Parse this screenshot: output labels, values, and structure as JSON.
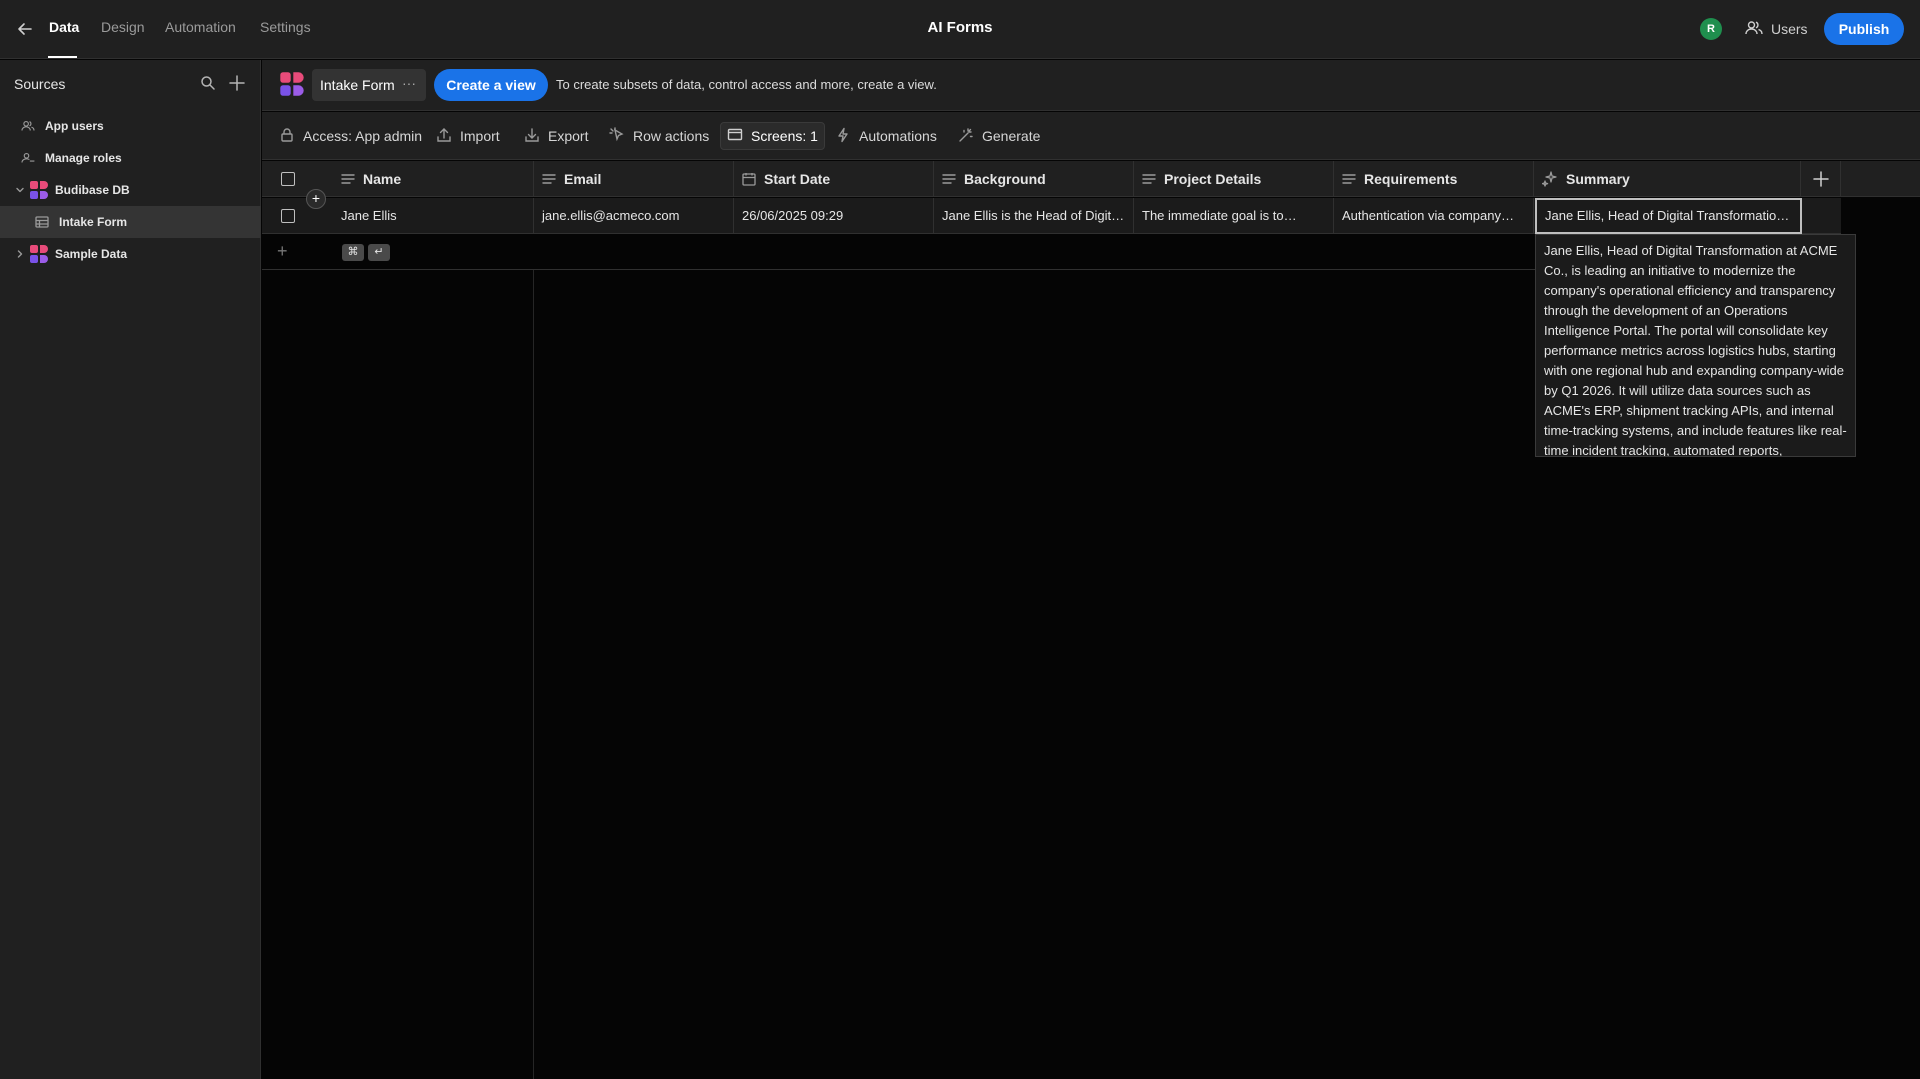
{
  "nav": {
    "tabs": [
      "Data",
      "Design",
      "Automation",
      "Settings"
    ],
    "active_tab": "Data"
  },
  "app": {
    "title": "AI Forms",
    "avatar_initial": "R",
    "users_label": "Users",
    "publish_label": "Publish"
  },
  "sidebar": {
    "title": "Sources",
    "items": [
      {
        "label": "App users",
        "icon": "users-icon"
      },
      {
        "label": "Manage roles",
        "icon": "user-roles-icon"
      },
      {
        "label": "Budibase DB",
        "icon": "budibase-db-logo",
        "expanded": true
      },
      {
        "label": "Intake Form",
        "icon": "table-icon",
        "selected": true
      },
      {
        "label": "Sample Data",
        "icon": "budibase-db-logo",
        "expanded": false
      }
    ]
  },
  "header": {
    "table_name": "Intake Form",
    "more_label": "···",
    "create_view_label": "Create a view",
    "hint": "To create subsets of data, control access and more, create a view."
  },
  "toolbar": {
    "access": "Access: App admin",
    "import": "Import",
    "export": "Export",
    "row_actions": "Row actions",
    "screens": "Screens: 1",
    "automations": "Automations",
    "generate": "Generate"
  },
  "grid": {
    "columns": [
      {
        "label": "Name",
        "icon": "text-icon"
      },
      {
        "label": "Email",
        "icon": "text-icon"
      },
      {
        "label": "Start Date",
        "icon": "calendar-icon"
      },
      {
        "label": "Background",
        "icon": "text-icon"
      },
      {
        "label": "Project Details",
        "icon": "text-icon"
      },
      {
        "label": "Requirements",
        "icon": "text-icon"
      },
      {
        "label": "Summary",
        "icon": "ai-sparkle-icon"
      }
    ],
    "rows": [
      {
        "name": "Jane Ellis",
        "email": "jane.ellis@acmeco.com",
        "start_date": "26/06/2025 09:29",
        "background": "Jane Ellis is the Head of Digit…",
        "project_details": "The immediate goal is to…",
        "requirements": "Authentication via company…",
        "summary": "Jane Ellis, Head of Digital Transformatio…"
      }
    ],
    "new_row_shortcut": [
      "⌘",
      "↵"
    ]
  },
  "summary_expanded": "Jane Ellis, Head of Digital Transformation at ACME Co., is leading an initiative to modernize the company's operational efficiency and transparency through the development of an Operations Intelligence Portal. The portal will consolidate key performance metrics across logistics hubs, starting with one regional hub and expanding company-wide by Q1 2026. It will utilize data sources such as ACME's ERP, shipment tracking APIs, and internal time-tracking systems, and include features like real-time incident tracking, automated reports,",
  "colors": {
    "accent": "#1a73e8",
    "topbar_bg": "#202020",
    "canvas_bg": "#050505",
    "avatar": "#1f8f4e"
  }
}
